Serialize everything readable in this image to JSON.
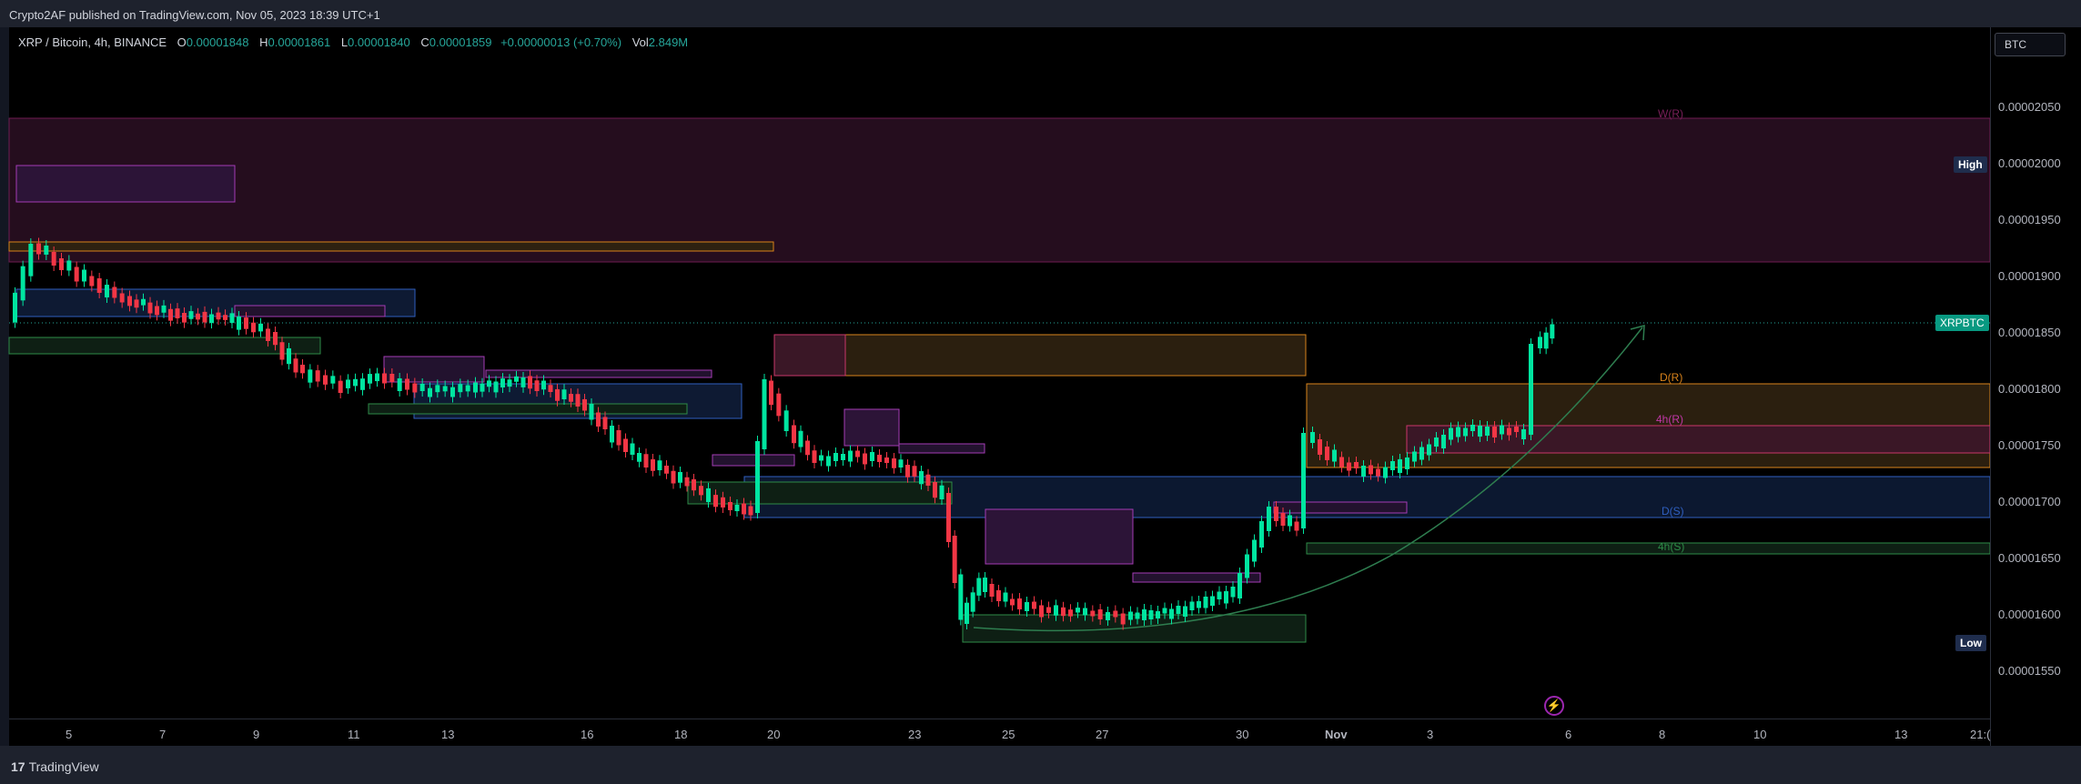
{
  "header": {
    "published_text": "Crypto2AF published on TradingView.com, Nov 05, 2023 18:39 UTC+1"
  },
  "legend": {
    "symbol": "XRP / Bitcoin, 4h, BINANCE",
    "o_key": "O",
    "o_val": "0.00001848",
    "h_key": "H",
    "h_val": "0.00001861",
    "l_key": "L",
    "l_val": "0.00001840",
    "c_key": "C",
    "c_val": "0.00001859",
    "change": "+0.00000013 (+0.70%)",
    "vol_key": "Vol",
    "vol_val": "2.849M"
  },
  "currency_button": "BTC",
  "price_axis": {
    "ticks": [
      "0.00002050",
      "0.00002000",
      "0.00001950",
      "0.00001900",
      "0.00001850",
      "0.00001800",
      "0.00001750",
      "0.00001700",
      "0.00001650",
      "0.00001600",
      "0.00001550"
    ],
    "high_tag": "High",
    "low_tag": "Low",
    "symbol_tag": "XRPBTC"
  },
  "time_axis": {
    "ticks": [
      "5",
      "7",
      "9",
      "11",
      "13",
      "16",
      "18",
      "20",
      "23",
      "25",
      "27",
      "30",
      "Nov",
      "3",
      "6",
      "8",
      "10",
      "13",
      "21:("
    ]
  },
  "zones": {
    "w_r": "W(R)",
    "d_r": "D(R)",
    "h4_r": "4h(R)",
    "d_s": "D(S)",
    "h4_s": "4h(S)"
  },
  "colors": {
    "up": "#26a69a",
    "down": "#ef5350",
    "accent_up": "#00e5a0",
    "accent_down": "#f23645"
  },
  "footer": {
    "brand": "TradingView"
  }
}
